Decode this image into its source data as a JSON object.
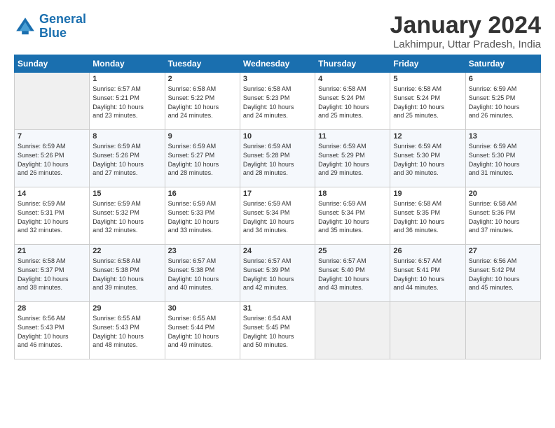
{
  "logo": {
    "line1": "General",
    "line2": "Blue"
  },
  "title": "January 2024",
  "subtitle": "Lakhimpur, Uttar Pradesh, India",
  "days_header": [
    "Sunday",
    "Monday",
    "Tuesday",
    "Wednesday",
    "Thursday",
    "Friday",
    "Saturday"
  ],
  "weeks": [
    [
      {
        "day": "",
        "info": ""
      },
      {
        "day": "1",
        "info": "Sunrise: 6:57 AM\nSunset: 5:21 PM\nDaylight: 10 hours\nand 23 minutes."
      },
      {
        "day": "2",
        "info": "Sunrise: 6:58 AM\nSunset: 5:22 PM\nDaylight: 10 hours\nand 24 minutes."
      },
      {
        "day": "3",
        "info": "Sunrise: 6:58 AM\nSunset: 5:23 PM\nDaylight: 10 hours\nand 24 minutes."
      },
      {
        "day": "4",
        "info": "Sunrise: 6:58 AM\nSunset: 5:24 PM\nDaylight: 10 hours\nand 25 minutes."
      },
      {
        "day": "5",
        "info": "Sunrise: 6:58 AM\nSunset: 5:24 PM\nDaylight: 10 hours\nand 25 minutes."
      },
      {
        "day": "6",
        "info": "Sunrise: 6:59 AM\nSunset: 5:25 PM\nDaylight: 10 hours\nand 26 minutes."
      }
    ],
    [
      {
        "day": "7",
        "info": "Sunrise: 6:59 AM\nSunset: 5:26 PM\nDaylight: 10 hours\nand 26 minutes."
      },
      {
        "day": "8",
        "info": "Sunrise: 6:59 AM\nSunset: 5:26 PM\nDaylight: 10 hours\nand 27 minutes."
      },
      {
        "day": "9",
        "info": "Sunrise: 6:59 AM\nSunset: 5:27 PM\nDaylight: 10 hours\nand 28 minutes."
      },
      {
        "day": "10",
        "info": "Sunrise: 6:59 AM\nSunset: 5:28 PM\nDaylight: 10 hours\nand 28 minutes."
      },
      {
        "day": "11",
        "info": "Sunrise: 6:59 AM\nSunset: 5:29 PM\nDaylight: 10 hours\nand 29 minutes."
      },
      {
        "day": "12",
        "info": "Sunrise: 6:59 AM\nSunset: 5:30 PM\nDaylight: 10 hours\nand 30 minutes."
      },
      {
        "day": "13",
        "info": "Sunrise: 6:59 AM\nSunset: 5:30 PM\nDaylight: 10 hours\nand 31 minutes."
      }
    ],
    [
      {
        "day": "14",
        "info": "Sunrise: 6:59 AM\nSunset: 5:31 PM\nDaylight: 10 hours\nand 32 minutes."
      },
      {
        "day": "15",
        "info": "Sunrise: 6:59 AM\nSunset: 5:32 PM\nDaylight: 10 hours\nand 32 minutes."
      },
      {
        "day": "16",
        "info": "Sunrise: 6:59 AM\nSunset: 5:33 PM\nDaylight: 10 hours\nand 33 minutes."
      },
      {
        "day": "17",
        "info": "Sunrise: 6:59 AM\nSunset: 5:34 PM\nDaylight: 10 hours\nand 34 minutes."
      },
      {
        "day": "18",
        "info": "Sunrise: 6:59 AM\nSunset: 5:34 PM\nDaylight: 10 hours\nand 35 minutes."
      },
      {
        "day": "19",
        "info": "Sunrise: 6:58 AM\nSunset: 5:35 PM\nDaylight: 10 hours\nand 36 minutes."
      },
      {
        "day": "20",
        "info": "Sunrise: 6:58 AM\nSunset: 5:36 PM\nDaylight: 10 hours\nand 37 minutes."
      }
    ],
    [
      {
        "day": "21",
        "info": "Sunrise: 6:58 AM\nSunset: 5:37 PM\nDaylight: 10 hours\nand 38 minutes."
      },
      {
        "day": "22",
        "info": "Sunrise: 6:58 AM\nSunset: 5:38 PM\nDaylight: 10 hours\nand 39 minutes."
      },
      {
        "day": "23",
        "info": "Sunrise: 6:57 AM\nSunset: 5:38 PM\nDaylight: 10 hours\nand 40 minutes."
      },
      {
        "day": "24",
        "info": "Sunrise: 6:57 AM\nSunset: 5:39 PM\nDaylight: 10 hours\nand 42 minutes."
      },
      {
        "day": "25",
        "info": "Sunrise: 6:57 AM\nSunset: 5:40 PM\nDaylight: 10 hours\nand 43 minutes."
      },
      {
        "day": "26",
        "info": "Sunrise: 6:57 AM\nSunset: 5:41 PM\nDaylight: 10 hours\nand 44 minutes."
      },
      {
        "day": "27",
        "info": "Sunrise: 6:56 AM\nSunset: 5:42 PM\nDaylight: 10 hours\nand 45 minutes."
      }
    ],
    [
      {
        "day": "28",
        "info": "Sunrise: 6:56 AM\nSunset: 5:43 PM\nDaylight: 10 hours\nand 46 minutes."
      },
      {
        "day": "29",
        "info": "Sunrise: 6:55 AM\nSunset: 5:43 PM\nDaylight: 10 hours\nand 48 minutes."
      },
      {
        "day": "30",
        "info": "Sunrise: 6:55 AM\nSunset: 5:44 PM\nDaylight: 10 hours\nand 49 minutes."
      },
      {
        "day": "31",
        "info": "Sunrise: 6:54 AM\nSunset: 5:45 PM\nDaylight: 10 hours\nand 50 minutes."
      },
      {
        "day": "",
        "info": ""
      },
      {
        "day": "",
        "info": ""
      },
      {
        "day": "",
        "info": ""
      }
    ]
  ]
}
